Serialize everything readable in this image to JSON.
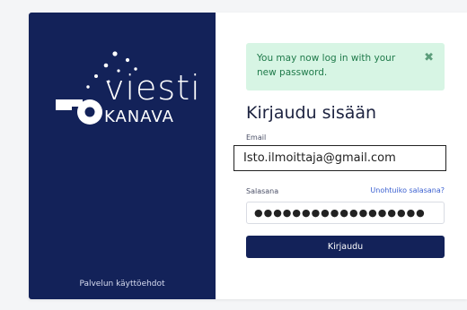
{
  "brand": {
    "logo_main": "viesti",
    "logo_sub": "KANAVA",
    "terms_label": "Palvelun käyttöehdot"
  },
  "alert": {
    "message": "You may now log in with your new password.",
    "close_glyph": "✖"
  },
  "form": {
    "title": "Kirjaudu sisään",
    "email_label": "Email",
    "email_value": "Isto.ilmoittaja@gmail.com",
    "password_label": "Salasana",
    "forgot_label": "Unohtuiko salasana?",
    "password_value": "●●●●●●●●●●●●●●●●●●",
    "submit_label": "Kirjaudu"
  },
  "colors": {
    "brand_navy": "#132259",
    "alert_bg": "#d7f5e4",
    "alert_text": "#1f7a4a",
    "link": "#3a5fd0"
  }
}
